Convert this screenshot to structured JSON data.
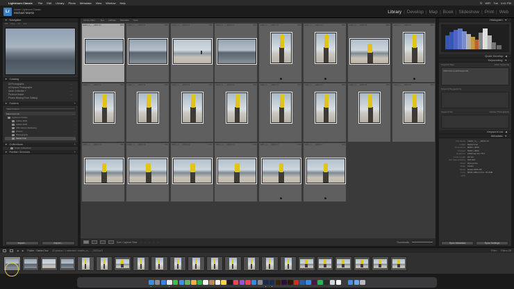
{
  "menubar": {
    "app_name": "Lightroom Classic",
    "items": [
      "File",
      "Edit",
      "Library",
      "Photo",
      "Metadata",
      "View",
      "Window",
      "Help"
    ],
    "status": [
      "⏻",
      "WiFi",
      "Tue",
      "9:41 PM"
    ]
  },
  "identity": {
    "line1": "Adobe Lightroom Classic",
    "line2": "Michael Martin"
  },
  "modules": [
    {
      "label": "Library",
      "active": true
    },
    {
      "label": "Develop",
      "active": false
    },
    {
      "label": "Map",
      "active": false
    },
    {
      "label": "Book",
      "active": false
    },
    {
      "label": "Slideshow",
      "active": false
    },
    {
      "label": "Print",
      "active": false
    },
    {
      "label": "Web",
      "active": false
    }
  ],
  "left_panel": {
    "navigator": {
      "title": "Navigator",
      "modes": [
        "FIT",
        "FILL",
        "1:1",
        "1:4"
      ]
    },
    "catalog": {
      "title": "Catalog",
      "items": [
        {
          "label": "All Photographs",
          "count": "…"
        },
        {
          "label": "All Synced Photographs",
          "count": "…"
        },
        {
          "label": "Quick Collection +",
          "count": "…"
        },
        {
          "label": "Previous Import",
          "count": "…"
        },
        {
          "label": "Photos Missing From Catalog",
          "count": "…"
        }
      ]
    },
    "folders": {
      "title": "Folders",
      "search_placeholder": "Filter Folders",
      "volume": {
        "label": "Macintosh HD",
        "count": "…"
      },
      "tree": [
        {
          "label": "Lightroom Folder",
          "count": "…",
          "selected": false
        },
        {
          "label": "Adobe 2023",
          "count": "…",
          "selected": false
        },
        {
          "label": "Adobe 2022",
          "count": "…",
          "selected": false
        },
        {
          "label": "Affirmations Marketing",
          "count": "…",
          "selected": false
        },
        {
          "label": "Photos",
          "count": "…",
          "selected": false
        },
        {
          "label": "Photographs",
          "count": "…",
          "selected": false
        },
        {
          "label": "Santa Cruz",
          "count": "…",
          "selected": true
        }
      ]
    },
    "collections": {
      "title": "Collections",
      "items": [
        "Smart Collections"
      ]
    },
    "publish": {
      "title": "Publish Services"
    },
    "import_btn": "Import...",
    "export_btn": "Export..."
  },
  "grid": {
    "top_text": [
      "Library Filter :",
      "Text",
      "Attribute",
      "Metadata",
      "None"
    ],
    "filename_prefix": "martin_m_…_2023.cr3",
    "ext": "CR3",
    "thumbs": [
      {
        "kind": "sea",
        "selected": true
      },
      {
        "kind": "sea"
      },
      {
        "kind": "beach"
      },
      {
        "kind": "sea"
      },
      {
        "kind": "bolly"
      },
      {
        "kind": "bolly"
      },
      {
        "kind": "bollw"
      },
      {
        "kind": "bolly"
      },
      {
        "kind": "bolly"
      },
      {
        "kind": "bolly"
      },
      {
        "kind": "bolly"
      },
      {
        "kind": "bolly"
      },
      {
        "kind": "bolly"
      },
      {
        "kind": "bolly"
      },
      {
        "kind": "bolly"
      },
      {
        "kind": "bolly"
      },
      {
        "kind": "bollw"
      },
      {
        "kind": "bollw"
      },
      {
        "kind": "bollw"
      },
      {
        "kind": "bollw"
      },
      {
        "kind": "bollw"
      },
      {
        "kind": "bollw"
      }
    ]
  },
  "toolbar": {
    "sort_label": "Sort: Capture Time",
    "stars": "☆ ☆ ☆ ☆ ☆",
    "thumbnails_label": "Thumbnails"
  },
  "right_panel": {
    "histogram_title": "Histogram",
    "quick_develop": "Quick Develop",
    "keywording": "Keywording",
    "keyword_tags_label": "Keyword Tags",
    "keyword_tags_value": "Enter Keywords",
    "keyword_text": "Click here to add keywords",
    "keyword_suggestions": "Keyword Suggestions",
    "keyword_set": "Keyword Set",
    "keyword_set_value": "Outdoor Photography",
    "keyword_list": "Keyword List",
    "metadata": "Metadata",
    "meta_rows": [
      {
        "k": "File Name",
        "v": "martin_m_…_2023.cr3"
      },
      {
        "k": "Folder",
        "v": "Santa Cruz"
      },
      {
        "k": "Dimensions",
        "v": "6000 x 4000"
      },
      {
        "k": "Cropped",
        "v": "6000 x 4000"
      },
      {
        "k": "Exposure",
        "v": "1/500 sec at f / 8.0"
      },
      {
        "k": "Focal Length",
        "v": "24 mm"
      },
      {
        "k": "ISO Speed Rating",
        "v": "ISO 100"
      },
      {
        "k": "Flash",
        "v": "Did not fire"
      },
      {
        "k": "Make",
        "v": "Canon"
      },
      {
        "k": "Model",
        "v": "Canon EOS R5"
      },
      {
        "k": "Lens",
        "v": "RF24-105mm F4 L IS USM"
      },
      {
        "k": "GPS",
        "v": ""
      }
    ],
    "sync_btn": "Sync Metadata",
    "sync_settings_btn": "Sync Settings"
  },
  "filmstrip_header": {
    "path": "Folder : Santa Cruz",
    "count": "22 photos / 1 selected / martin_m_…_2023.cr3",
    "filter": "Filter :",
    "filter_value": "Filters Off"
  },
  "filmstrip": {
    "thumbs": [
      {
        "kind": "sea",
        "port": false,
        "selected": true
      },
      {
        "kind": "sea",
        "port": false
      },
      {
        "kind": "beach",
        "port": false
      },
      {
        "kind": "sea",
        "port": false
      },
      {
        "kind": "bolly",
        "port": true
      },
      {
        "kind": "bolly",
        "port": true
      },
      {
        "kind": "bollw",
        "port": false
      },
      {
        "kind": "bolly",
        "port": true
      },
      {
        "kind": "bolly",
        "port": true
      },
      {
        "kind": "bolly",
        "port": true
      },
      {
        "kind": "bolly",
        "port": true
      },
      {
        "kind": "bolly",
        "port": true
      },
      {
        "kind": "bolly",
        "port": true
      },
      {
        "kind": "bolly",
        "port": true
      },
      {
        "kind": "bolly",
        "port": true
      },
      {
        "kind": "bolly",
        "port": true
      },
      {
        "kind": "bollw",
        "port": false
      },
      {
        "kind": "bollw",
        "port": false
      },
      {
        "kind": "bollw",
        "port": false
      },
      {
        "kind": "bollw",
        "port": false
      },
      {
        "kind": "bollw",
        "port": false
      },
      {
        "kind": "bollw",
        "port": false
      }
    ]
  },
  "dock": {
    "apps": [
      {
        "name": "finder-icon",
        "color": "#3b8ee6",
        "running": true
      },
      {
        "name": "launchpad-icon",
        "color": "#8d8d95"
      },
      {
        "name": "safari-icon",
        "color": "#2f86e8"
      },
      {
        "name": "chrome-icon",
        "color": "#e7e7e7",
        "running": true
      },
      {
        "name": "messages-icon",
        "color": "#38c44a"
      },
      {
        "name": "mail-icon",
        "color": "#3a8ff0"
      },
      {
        "name": "maps-icon",
        "color": "#67b35e"
      },
      {
        "name": "photos-icon",
        "color": "#f0b13b"
      },
      {
        "name": "facetime-icon",
        "color": "#33b24a"
      },
      {
        "name": "calendar-icon",
        "color": "#f4f4f4"
      },
      {
        "name": "contacts-icon",
        "color": "#b58b5c"
      },
      {
        "name": "reminders-icon",
        "color": "#f1f1f1"
      },
      {
        "name": "notes-icon",
        "color": "#f5d34a"
      },
      {
        "name": "tv-icon",
        "color": "#1c1c1c"
      },
      {
        "name": "music-icon",
        "color": "#f0445c"
      },
      {
        "name": "podcasts-icon",
        "color": "#9a4fe0"
      },
      {
        "name": "news-icon",
        "color": "#f0445c"
      },
      {
        "name": "appstore-icon",
        "color": "#2d8cf0"
      },
      {
        "name": "settings-icon",
        "color": "#8a8a8f"
      },
      {
        "name": "photoshop-icon",
        "color": "#1a2a4a",
        "running": true
      },
      {
        "name": "lightroom-icon",
        "color": "#1a2c4d",
        "running": true
      },
      {
        "name": "illustrator-icon",
        "color": "#3a2108"
      },
      {
        "name": "premiere-icon",
        "color": "#2a0f3a"
      },
      {
        "name": "bridge-icon",
        "color": "#2a1a08"
      },
      {
        "name": "acrobat-icon",
        "color": "#d42c22"
      },
      {
        "name": "word-icon",
        "color": "#2a5caa"
      },
      {
        "name": "zoom-icon",
        "color": "#2d8cf0"
      },
      {
        "name": "slack-icon",
        "color": "#4a154b"
      },
      {
        "name": "spotify-icon",
        "color": "#1db954"
      },
      {
        "name": "terminal-icon",
        "color": "#2a2a2a"
      },
      {
        "name": "preview-icon",
        "color": "#cfd6dd"
      },
      {
        "name": "textedit-icon",
        "color": "#f5f5f5"
      },
      {
        "name": "activity-icon",
        "color": "#3a3a3a"
      },
      {
        "name": "downloads-icon",
        "color": "#4b8de6"
      },
      {
        "name": "folder-icon",
        "color": "#6aa8e8"
      },
      {
        "name": "trash-icon",
        "color": "#b8bcc2"
      }
    ]
  }
}
